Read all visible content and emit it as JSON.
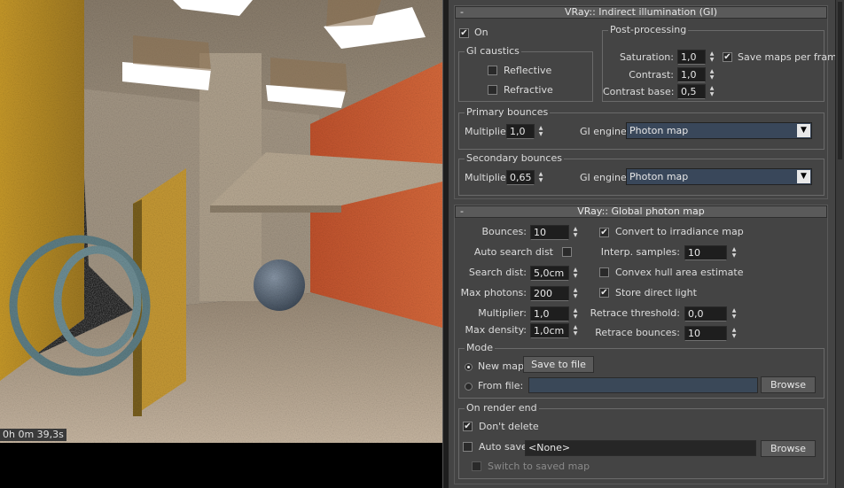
{
  "viewport": {
    "render_time": "0h 0m 39,3s"
  },
  "gi": {
    "title": "VRay:: Indirect illumination (GI)",
    "collapse": "-",
    "on_label": "On",
    "on_checked": true,
    "caustics": {
      "title": "GI caustics",
      "reflective": "Reflective",
      "reflective_checked": false,
      "refractive": "Refractive",
      "refractive_checked": false
    },
    "post": {
      "title": "Post-processing",
      "saturation_label": "Saturation:",
      "saturation": "1,0",
      "contrast_label": "Contrast:",
      "contrast": "1,0",
      "contrast_base_label": "Contrast base:",
      "contrast_base": "0,5",
      "save_maps_label": "Save maps per frame",
      "save_maps_checked": true
    },
    "primary": {
      "title": "Primary bounces",
      "multiplier_label": "Multiplier:",
      "multiplier": "1,0",
      "engine_label": "GI engine:",
      "engine": "Photon map"
    },
    "secondary": {
      "title": "Secondary bounces",
      "multiplier_label": "Multiplier:",
      "multiplier": "0,65",
      "engine_label": "GI engine:",
      "engine": "Photon map"
    }
  },
  "photon": {
    "title": "VRay:: Global photon map",
    "collapse": "-",
    "bounces_label": "Bounces:",
    "bounces": "10",
    "auto_search_label": "Auto search dist",
    "auto_search_checked": false,
    "search_dist_label": "Search dist:",
    "search_dist": "5,0cm",
    "max_photons_label": "Max photons:",
    "max_photons": "200",
    "multiplier_label": "Multiplier:",
    "multiplier": "1,0",
    "max_density_label": "Max density:",
    "max_density": "1,0cm",
    "convert_label": "Convert to irradiance map",
    "convert_checked": true,
    "interp_label": "Interp. samples:",
    "interp": "10",
    "convex_label": "Convex hull area estimate",
    "convex_checked": false,
    "store_label": "Store direct light",
    "store_checked": true,
    "retrace_threshold_label": "Retrace threshold:",
    "retrace_threshold": "0,0",
    "retrace_bounces_label": "Retrace bounces:",
    "retrace_bounces": "10",
    "mode": {
      "title": "Mode",
      "new_map": "New map",
      "new_map_selected": true,
      "save_to_file": "Save to file",
      "from_file": "From file:",
      "from_file_value": "",
      "browse": "Browse"
    },
    "render_end": {
      "title": "On render end",
      "dont_delete": "Don't delete",
      "dont_delete_checked": true,
      "auto_save": "Auto save:",
      "auto_save_checked": false,
      "auto_save_value": "<None>",
      "browse": "Browse",
      "switch_label": "Switch to saved map",
      "switch_checked": false
    }
  },
  "colors": {
    "panel_bg": "#444444",
    "dropdown_bg": "#39475a",
    "field_bg": "#1e1e1e"
  }
}
